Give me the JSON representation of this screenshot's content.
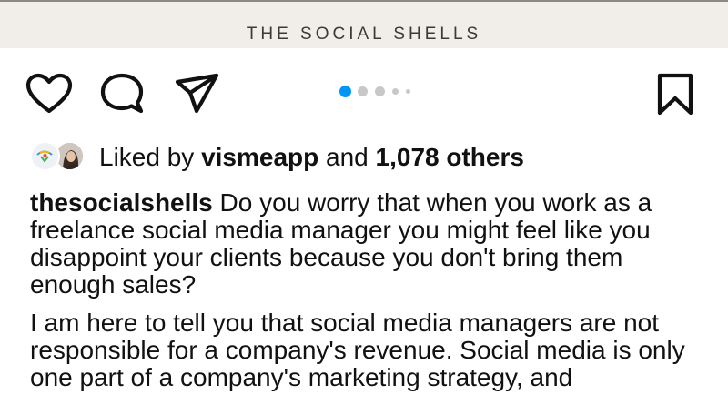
{
  "post_image": {
    "brand_text": "THE SOCIAL SHELLS"
  },
  "actions": {
    "like_icon": "heart-icon",
    "comment_icon": "comment-icon",
    "share_icon": "paper-plane-icon",
    "save_icon": "bookmark-icon"
  },
  "carousel": {
    "current_index": 1,
    "dot_count": 5,
    "active_color": "#0095f6",
    "inactive_color": "#c8c8c8"
  },
  "likes": {
    "prefix": "Liked by ",
    "user": "vismeapp",
    "middle": " and ",
    "count": "1,078 others"
  },
  "caption": {
    "username": "thesocialshells",
    "text_1": " Do you worry that when you work as a freelance social media manager you might feel like you disappoint your clients because you don't bring them enough sales?",
    "text_2": "I am here to tell you that social media managers are not responsible for a company's revenue. Social media is only one part of a company's marketing strategy, and"
  }
}
